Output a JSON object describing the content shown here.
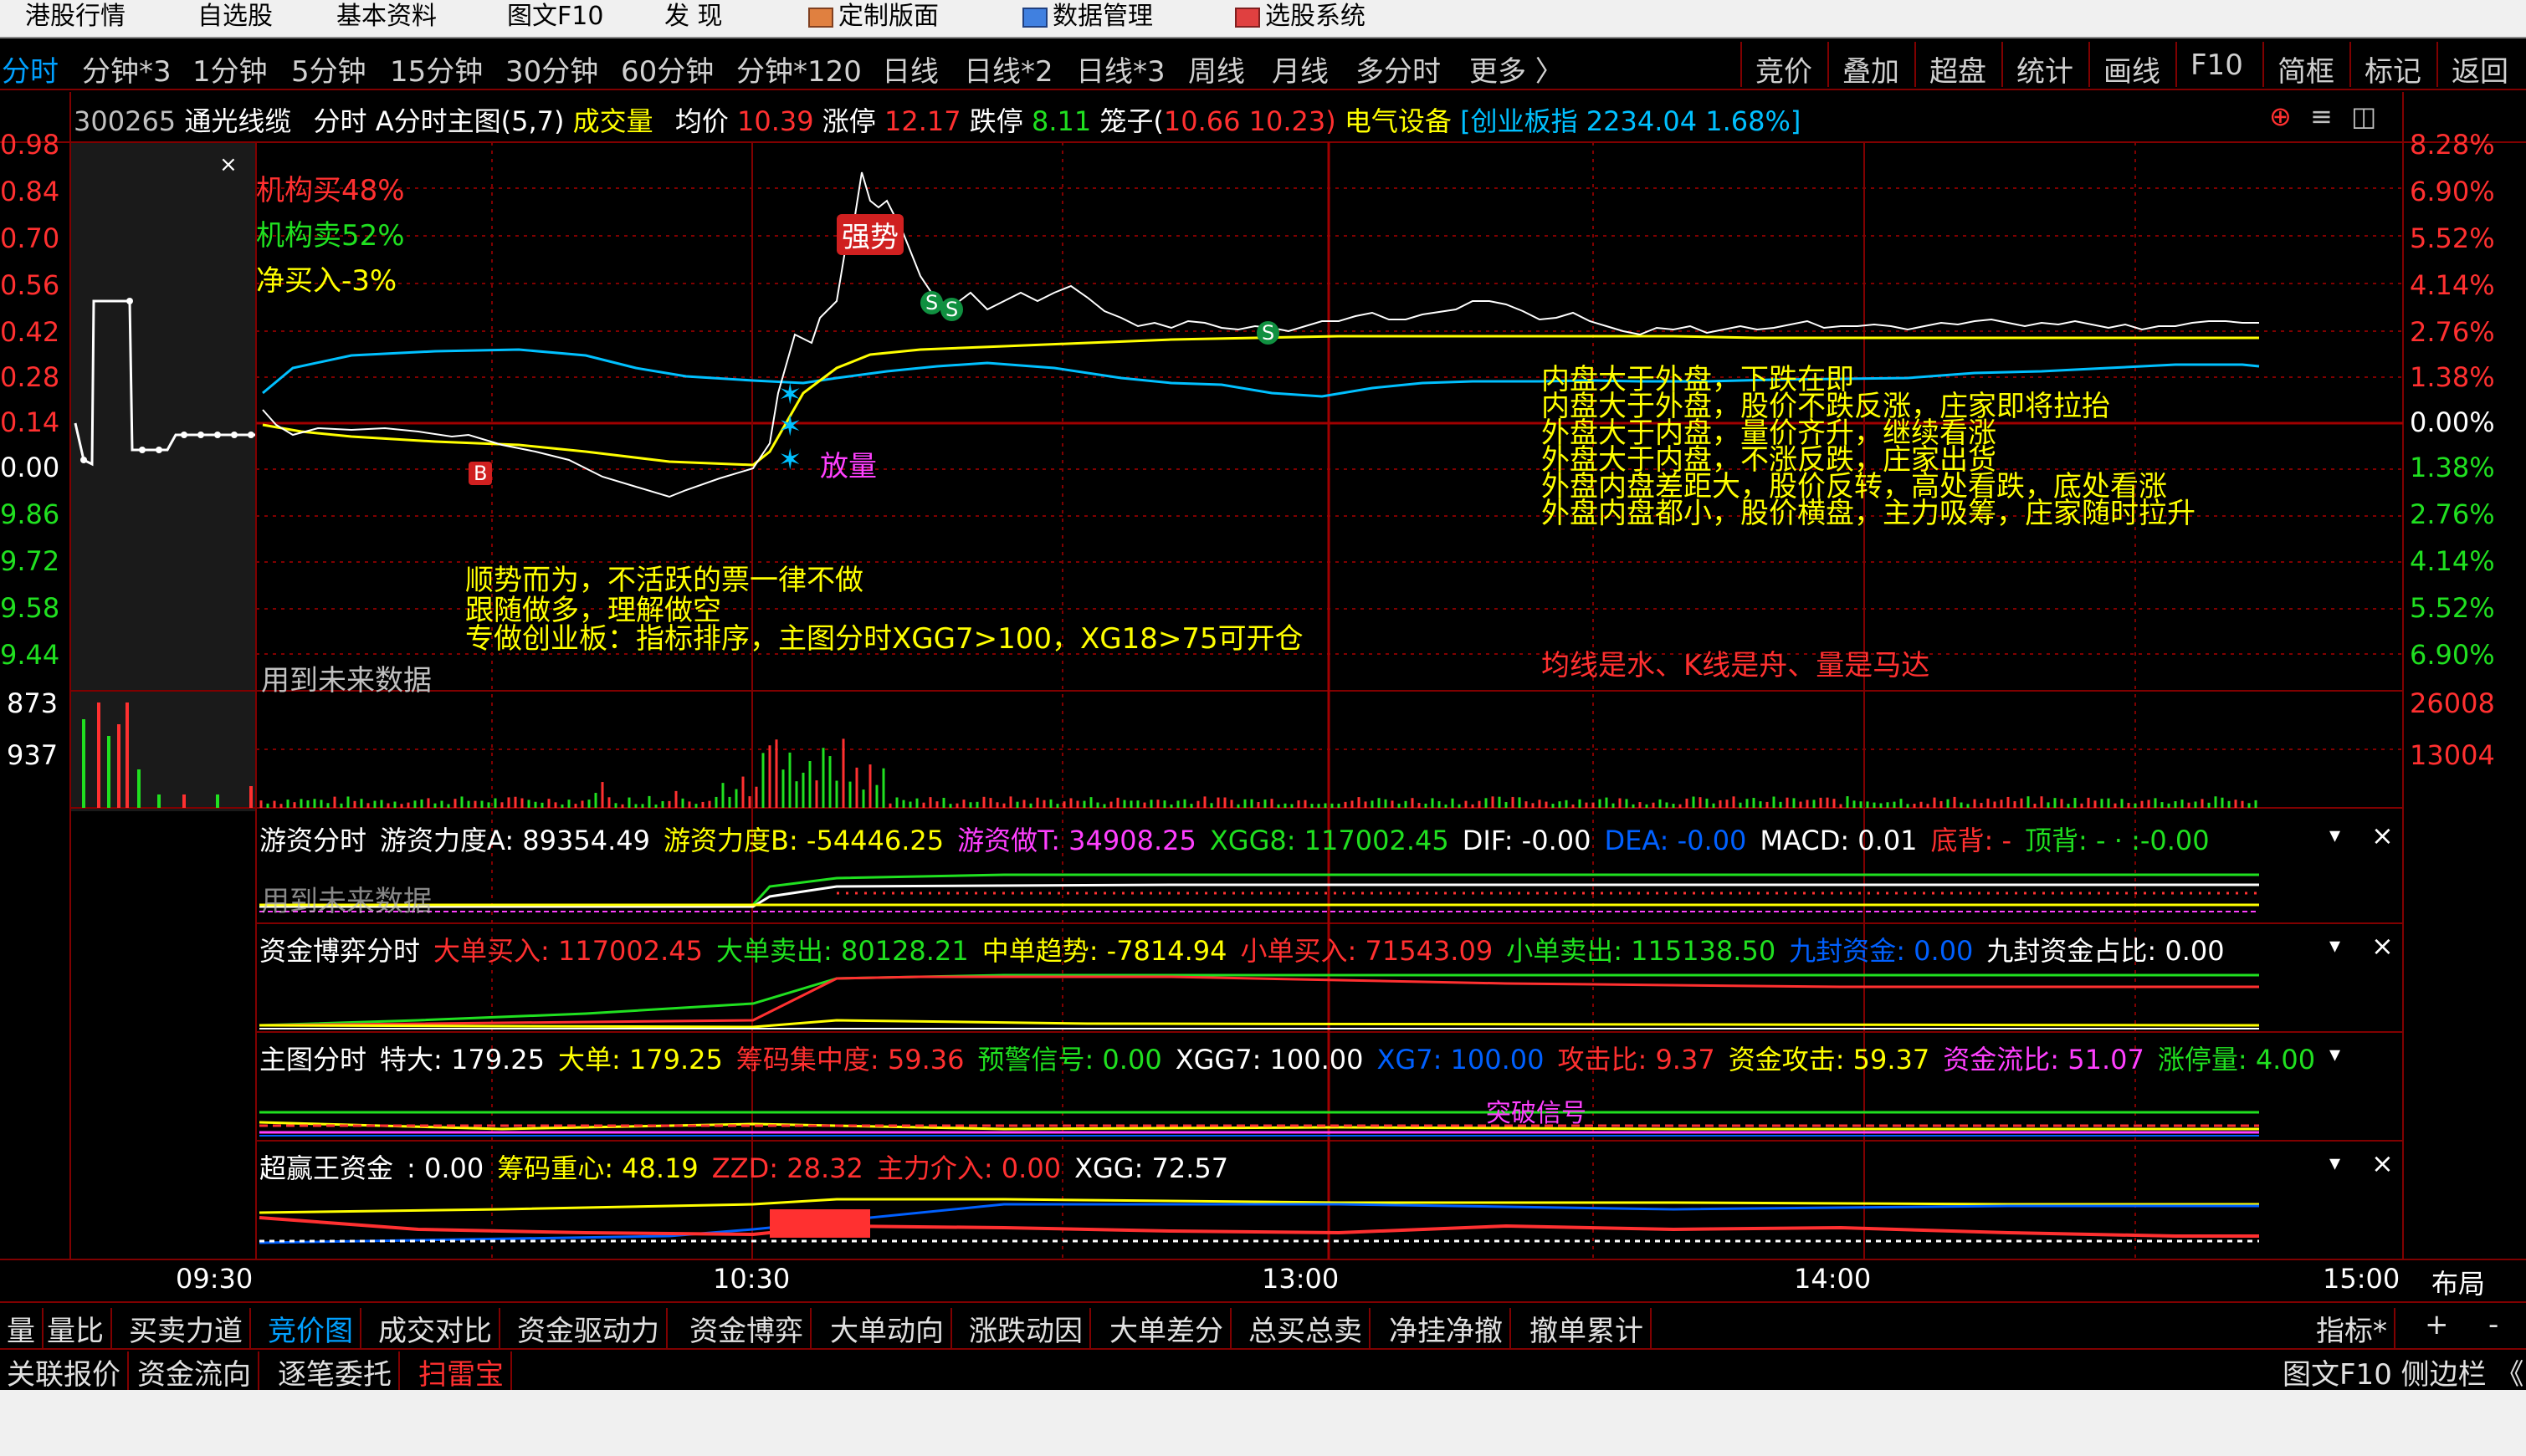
{
  "menu": [
    "港股行情",
    "自选股",
    "基本资料",
    "图文F10",
    "发  现",
    "定制版面",
    "数据管理",
    "选股系统"
  ],
  "periods": [
    "分时",
    "分钟*3",
    "1分钟",
    "5分钟",
    "15分钟",
    "30分钟",
    "60分钟",
    "分钟*120",
    "日线",
    "日线*2",
    "日线*3",
    "周线",
    "月线",
    "多分时",
    "更多 〉"
  ],
  "right_buttons": [
    "竞价",
    "叠加",
    "超盘",
    "统计",
    "画线",
    "F10",
    "简框",
    "标记",
    "返回"
  ],
  "header": {
    "code": "300265",
    "name": "通光线缆",
    "view": "分时",
    "indicator": "A分时主图(5,7)",
    "volume_label": "成交量",
    "avg_label": "均价",
    "avg_value": "10.39",
    "limit_up_label": "涨停",
    "limit_up_value": "12.17",
    "limit_down_label": "跌停",
    "limit_down_value": "8.11",
    "cage_label": "笼子(",
    "cage_v1": "10.66",
    "cage_v2": "10.23)",
    "sector": "电气设备",
    "index": "[创业板指 2234.04 1.68%]"
  },
  "left_axis": [
    "0.98",
    "0.84",
    "0.70",
    "0.56",
    "0.42",
    "0.28",
    "0.14",
    "0.00",
    "9.86",
    "9.72",
    "9.58",
    "9.44"
  ],
  "right_axis": [
    "8.28%",
    "6.90%",
    "5.52%",
    "4.14%",
    "2.76%",
    "1.38%",
    "0.00%",
    "1.38%",
    "2.76%",
    "4.14%",
    "5.52%",
    "6.90%"
  ],
  "volume_axis": {
    "left": [
      "873",
      "937"
    ],
    "right": [
      "26008",
      "13004"
    ]
  },
  "time_axis": [
    "09:30",
    "10:30",
    "13:00",
    "14:00",
    "15:00"
  ],
  "layout_label": "布局",
  "panel_close": "×",
  "annotations": {
    "inst_buy": "机构买48%",
    "inst_sell": "机构卖52%",
    "net_buy": "净买入-3%",
    "strong": "强势",
    "fangliang": "放量",
    "rules": [
      "顺势而为，不活跃的票一律不做",
      "跟随做多，理解做空",
      "专做创业板：指标排序，主图分时XGG7>100，XG18>75可开仓"
    ],
    "future_data": "用到未来数据",
    "future_data2": "用到未来数据",
    "signals": [
      "内盘大于外盘，下跌在即",
      "内盘大于外盘，股价不跌反涨，庄家即将拉抬",
      "外盘大于内盘，量价齐升，继续看涨",
      "外盘大于内盘，不涨反跌，庄家出货",
      "外盘内盘差距大，股价反转，高处看跌，底处看涨",
      "外盘内盘都小，股价横盘，主力吸筹，庄家随时拉升"
    ],
    "motto": "均线是水、K线是舟、量是马达",
    "breakout": "突破信号"
  },
  "panels": {
    "youzi": {
      "title": "游资分时",
      "items": [
        {
          "label": "游资力度A:",
          "value": "89354.49",
          "color": "#ffffff"
        },
        {
          "label": "游资力度B:",
          "value": "-54446.25",
          "color": "#ffff00"
        },
        {
          "label": "游资做T:",
          "value": "34908.25",
          "color": "#ff40ff"
        },
        {
          "label": "XGG8:",
          "value": "117002.45",
          "color": "#20e020"
        },
        {
          "label": "DIF:",
          "value": "-0.00",
          "color": "#ffffff"
        },
        {
          "label": "DEA:",
          "value": "-0.00",
          "color": "#0060ff"
        },
        {
          "label": "MACD:",
          "value": "0.01",
          "color": "#ffffff"
        },
        {
          "label": "底背:",
          "value": "-",
          "color": "#ff3030"
        },
        {
          "label": "顶背:",
          "value": "- · :-0.00",
          "color": "#20e020"
        }
      ]
    },
    "zijin": {
      "title": "资金博弈分时",
      "items": [
        {
          "label": "大单买入:",
          "value": "117002.45",
          "color": "#ff3030"
        },
        {
          "label": "大单卖出:",
          "value": "80128.21",
          "color": "#20e020"
        },
        {
          "label": "中单趋势:",
          "value": "-7814.94",
          "color": "#ffff00"
        },
        {
          "label": "小单买入:",
          "value": "71543.09",
          "color": "#ff3030"
        },
        {
          "label": "小单卖出:",
          "value": "115138.50",
          "color": "#20e020"
        },
        {
          "label": "九封资金:",
          "value": "0.00",
          "color": "#0060ff"
        },
        {
          "label": "九封资金占比:",
          "value": "0.00",
          "color": "#ffffff"
        }
      ]
    },
    "zhutu": {
      "title": "主图分时",
      "items": [
        {
          "label": "特大:",
          "value": "179.25",
          "color": "#ffffff"
        },
        {
          "label": "大单:",
          "value": "179.25",
          "color": "#ffff00"
        },
        {
          "label": "筹码集中度:",
          "value": "59.36",
          "color": "#ff3030"
        },
        {
          "label": "预警信号:",
          "value": "0.00",
          "color": "#20e020"
        },
        {
          "label": "XGG7:",
          "value": "100.00",
          "color": "#ffffff"
        },
        {
          "label": "XG7:",
          "value": "100.00",
          "color": "#0060ff"
        },
        {
          "label": "攻击比:",
          "value": "9.37",
          "color": "#ff3030"
        },
        {
          "label": "资金攻击:",
          "value": "59.37",
          "color": "#ffff00"
        },
        {
          "label": "资金流比:",
          "value": "51.07",
          "color": "#ff40ff"
        },
        {
          "label": "涨停量:",
          "value": "4.00",
          "color": "#20e020"
        }
      ]
    },
    "chaoying": {
      "title": "超赢王资金",
      "items": [
        {
          "label": ":",
          "value": "0.00",
          "color": "#ffffff"
        },
        {
          "label": "筹码重心:",
          "value": "48.19",
          "color": "#ffff00"
        },
        {
          "label": "ZZD:",
          "value": "28.32",
          "color": "#ff3030"
        },
        {
          "label": "主力介入:",
          "value": "0.00",
          "color": "#ff3030"
        },
        {
          "label": "XGG:",
          "value": "72.57",
          "color": "#ffffff"
        }
      ]
    }
  },
  "bottom_tabs": [
    "量",
    "量比",
    "买卖力道",
    "竞价图",
    "成交对比",
    "资金驱动力",
    "资金博弈",
    "大单动向",
    "涨跌动因",
    "大单差分",
    "总买总卖",
    "净挂净撤",
    "撤单累计"
  ],
  "bottom_right": [
    "指标*",
    "+",
    "-"
  ],
  "bottom_tabs2": [
    "关联报价",
    "资金流向",
    "逐笔委托",
    "扫雷宝"
  ],
  "bottom_right2": "图文F10 侧边栏 《",
  "colors": {
    "up": "#ff3030",
    "down": "#20e020",
    "grid": "#800000",
    "price": "#ffffff",
    "avg": "#ffff00",
    "index": "#00c0ff",
    "active": "#00a0ff"
  }
}
